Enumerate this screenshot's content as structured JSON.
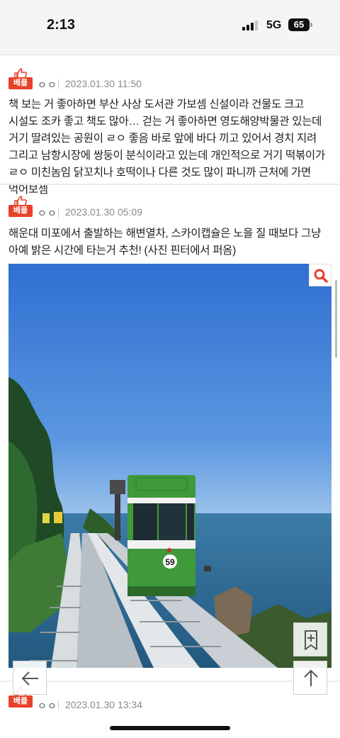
{
  "status_bar": {
    "time": "2:13",
    "network": "5G",
    "battery": "65"
  },
  "badge_label": "베플",
  "comments": [
    {
      "author": "ㅇㅇ",
      "timestamp": "2023.01.30 11:50",
      "text": "책 보는 거 좋아하면 부산 사상 도서관 가보셈 신설이라 건물도 크고 시설도 조카 좋고 책도 많아… 걷는 거 좋아하면 영도해양박물관 있는데 거기 딸려있는 공원이 ㄹㅇ 좋음 바로 앞에 바다 끼고 있어서 경치 지려 그리고 남항시장에 쌍둥이 분식이라고 있는데 개인적으로 거기 떡볶이가 ㄹㅇ 미친놈임 닭꼬치나 호떡이나 다른 것도 많이 파니까 근처에 가면 먹어보셈"
    },
    {
      "author": "ㅇㅇ",
      "timestamp": "2023.01.30 05:09",
      "text": "해운대 미포에서 출발하는 해변열차, 스카이캡슐은 노을 질 때보다 그냥 아예 밝은 시간에 타는거 추천! (사진 핀터에서 퍼옴)",
      "photo": {
        "car_number": "59"
      }
    },
    {
      "author": "ㅇㅇ",
      "timestamp": "2023.01.30 13:34"
    }
  ],
  "colors": {
    "badge": "#e8412b",
    "train_green": "#3f9a3a",
    "sky": "#3d7ed9",
    "sea": "#2d6d96"
  },
  "icons": {
    "zoom": "magnifier-icon",
    "bookmark": "bookmark-plus-icon",
    "back": "arrow-left-icon",
    "top": "arrow-up-icon"
  }
}
